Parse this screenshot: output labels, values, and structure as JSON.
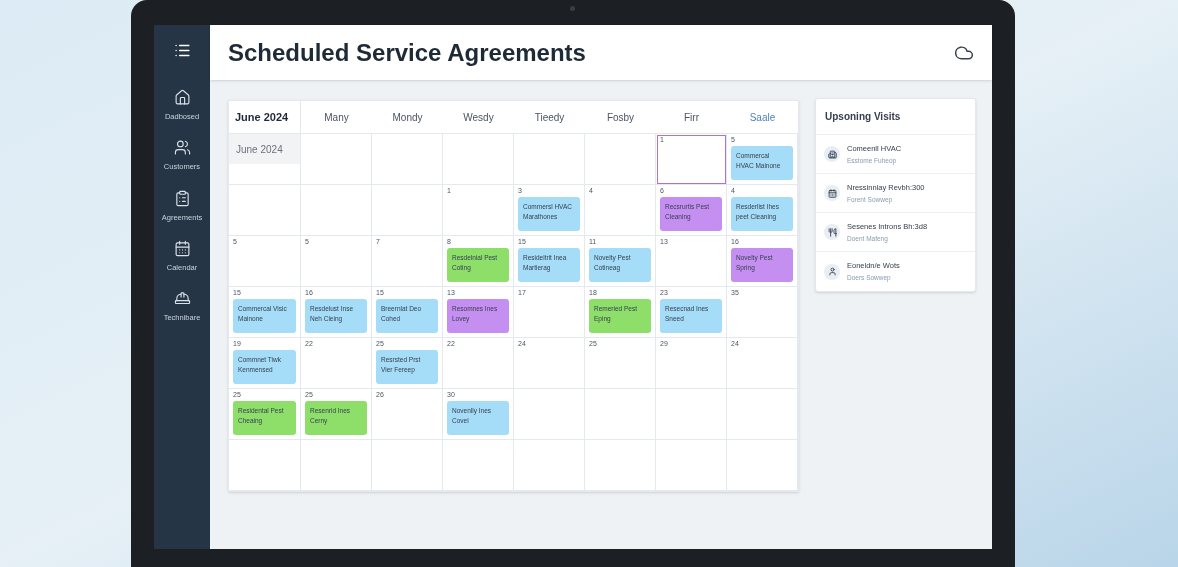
{
  "sidebar": {
    "items": [
      {
        "label": "Dadbosed"
      },
      {
        "label": "Customers"
      },
      {
        "label": "Agreements"
      },
      {
        "label": "Calendar"
      },
      {
        "label": "Technibare"
      }
    ]
  },
  "header": {
    "title": "Scheduled Service Agreements"
  },
  "calendar": {
    "columns": [
      {
        "label": "June 2024",
        "kind": "month"
      },
      {
        "label": "Many",
        "kind": "day",
        "selected": false
      },
      {
        "label": "Mondy",
        "kind": "day",
        "selected": false
      },
      {
        "label": "Wesdy",
        "kind": "day",
        "selected": false
      },
      {
        "label": "Tieedy",
        "kind": "day",
        "selected": false
      },
      {
        "label": "Fosby",
        "kind": "day",
        "selected": false
      },
      {
        "label": "Firr",
        "kind": "day",
        "selected": false
      },
      {
        "label": "Saale",
        "kind": "day",
        "selected": true
      }
    ],
    "rows": [
      [
        {
          "kind": "label",
          "text": "June 2024"
        },
        {},
        {},
        {},
        {},
        {},
        {
          "day": "1",
          "selected": true
        },
        {
          "day": "5",
          "events": [
            {
              "label": "Commercal HVAC Mainone",
              "color": "#a5dcf7"
            }
          ]
        }
      ],
      [
        {},
        {},
        {},
        {
          "day": "1"
        },
        {
          "day": "3",
          "events": [
            {
              "label": "Commersl HVAC Marathones",
              "color": "#a5dcf7"
            }
          ]
        },
        {
          "day": "4"
        },
        {
          "day": "6",
          "events": [
            {
              "label": "Recsrurtis Pest Cleaning",
              "color": "#c48ff0"
            }
          ]
        },
        {
          "day": "4",
          "events": [
            {
              "label": "Resderlist Ihes peet Cleaning",
              "color": "#a5dcf7"
            }
          ]
        }
      ],
      [
        {
          "day": "5"
        },
        {
          "day": "5"
        },
        {
          "day": "7"
        },
        {
          "day": "8",
          "events": [
            {
              "label": "Resdelnial Pest Coting",
              "color": "#8ede6a"
            }
          ]
        },
        {
          "day": "15",
          "events": [
            {
              "label": "Resideltrit Inea Martierag",
              "color": "#a5dcf7"
            }
          ]
        },
        {
          "day": "11",
          "events": [
            {
              "label": "Novelty Pest Cotineag",
              "color": "#a5dcf7"
            }
          ]
        },
        {
          "day": "13"
        },
        {
          "day": "16",
          "events": [
            {
              "label": "Novelty Pest Spring",
              "color": "#c48ff0"
            }
          ]
        }
      ],
      [
        {
          "day": "15",
          "events": [
            {
              "label": "Commercal Visic Mainone",
              "color": "#a5dcf7"
            }
          ]
        },
        {
          "day": "16",
          "events": [
            {
              "label": "Resdelust Inse Neh Cleing",
              "color": "#a5dcf7"
            }
          ]
        },
        {
          "day": "15",
          "events": [
            {
              "label": "Breernlat Deo Cohed",
              "color": "#a5dcf7"
            }
          ]
        },
        {
          "day": "13",
          "events": [
            {
              "label": "Resomnes Ines Lovey",
              "color": "#c48ff0"
            }
          ]
        },
        {
          "day": "17"
        },
        {
          "day": "18",
          "events": [
            {
              "label": "Remeried Pest Eping",
              "color": "#8ede6a"
            }
          ]
        },
        {
          "day": "23",
          "events": [
            {
              "label": "Resecnad Ines Sneed",
              "color": "#a5dcf7"
            }
          ]
        },
        {
          "day": "35"
        }
      ],
      [
        {
          "day": "19",
          "events": [
            {
              "label": "Commnet Tiwk Kenmensed",
              "color": "#a5dcf7"
            }
          ]
        },
        {
          "day": "22"
        },
        {
          "day": "25",
          "events": [
            {
              "label": "Resrsted Prst Vier Fereep",
              "color": "#a5dcf7"
            }
          ]
        },
        {
          "day": "22"
        },
        {
          "day": "24"
        },
        {
          "day": "25"
        },
        {
          "day": "29"
        },
        {
          "day": "24"
        }
      ],
      [
        {
          "day": "25",
          "events": [
            {
              "label": "Residental Pest Cheaing",
              "color": "#8ede6a"
            }
          ]
        },
        {
          "day": "25",
          "events": [
            {
              "label": "Resenrid Ines Cerny",
              "color": "#8ede6a"
            }
          ]
        },
        {
          "day": "26"
        },
        {
          "day": "30",
          "events": [
            {
              "label": "Novenlly Ines Covel",
              "color": "#a5dcf7"
            }
          ]
        },
        {},
        {},
        {},
        {}
      ],
      [
        {},
        {},
        {},
        {},
        {},
        {},
        {},
        {}
      ]
    ]
  },
  "upcoming": {
    "title": "Upsoning Visits",
    "items": [
      {
        "title": "Comeenll HVAC",
        "subtitle": "Esstome Fuheop"
      },
      {
        "title": "Nressinnlay Revbh:300",
        "subtitle": "Forent Sowwep"
      },
      {
        "title": "Sesenes Introns Bh:3d8",
        "subtitle": "Doent Mafeng"
      },
      {
        "title": "Eoneldn/e Wots",
        "subtitle": "Doers Sowwep"
      }
    ]
  }
}
